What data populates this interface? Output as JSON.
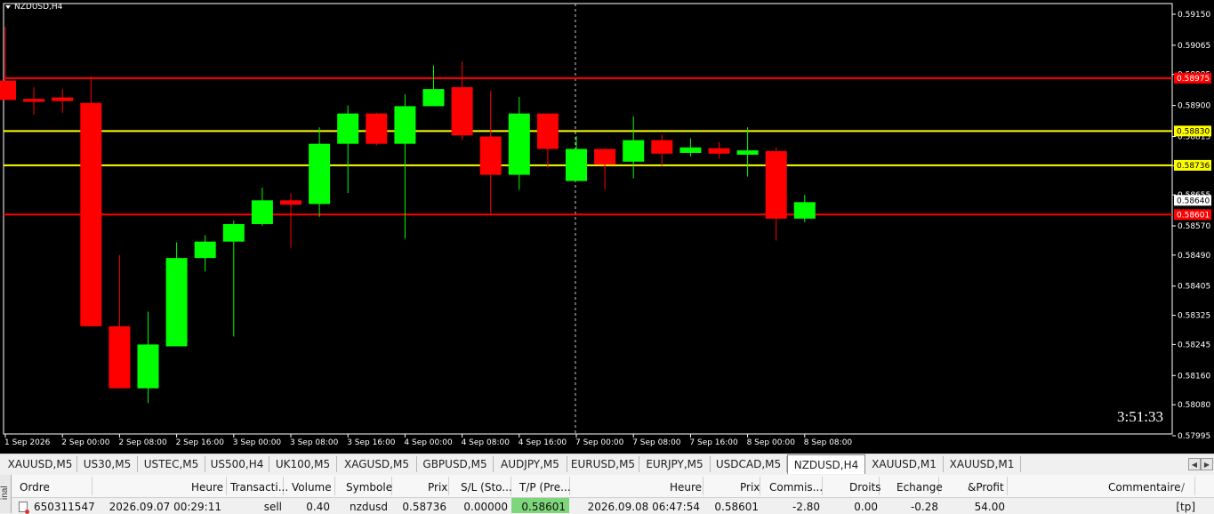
{
  "window": {
    "title": "NZDUSD,H4",
    "timer": "3:51:33"
  },
  "colors": {
    "bull": "#00ff00",
    "bear": "#ff0000",
    "background": "#000000",
    "support_resistance_red": "#ff0000",
    "yellow_level": "#ffff00",
    "tp_highlight": "#7ed67a"
  },
  "chart_data": {
    "type": "candlestick",
    "symbol": "NZDUSD",
    "timeframe": "H4",
    "ylim": [
      0.57995,
      0.5915
    ],
    "y_ticks": [
      0.5915,
      0.59065,
      0.58985,
      0.589,
      0.58815,
      0.58735,
      0.58655,
      0.5857,
      0.5849,
      0.58405,
      0.58325,
      0.58245,
      0.5816,
      0.5808,
      0.57995
    ],
    "y_tick_labels": [
      "0.59150",
      "0.59065",
      "0.58985",
      "0.58900",
      "0.58815",
      "0.58735",
      "0.58655",
      "0.58570",
      "0.58490",
      "0.58405",
      "0.58325",
      "0.58245",
      "0.58160",
      "0.58080",
      "0.57995"
    ],
    "x_tick_labels": [
      "1 Sep 2026",
      "2 Sep 00:00",
      "2 Sep 08:00",
      "2 Sep 16:00",
      "3 Sep 00:00",
      "3 Sep 08:00",
      "3 Sep 16:00",
      "4 Sep 00:00",
      "4 Sep 08:00",
      "4 Sep 16:00",
      "7 Sep 00:00",
      "7 Sep 08:00",
      "7 Sep 16:00",
      "8 Sep 00:00",
      "8 Sep 08:00"
    ],
    "candles": [
      {
        "o": 0.58968,
        "h": 0.59115,
        "l": 0.58915,
        "c": 0.58915
      },
      {
        "o": 0.58918,
        "h": 0.5895,
        "l": 0.58875,
        "c": 0.5891
      },
      {
        "o": 0.58922,
        "h": 0.58945,
        "l": 0.5888,
        "c": 0.58912
      },
      {
        "o": 0.58907,
        "h": 0.5898,
        "l": 0.58295,
        "c": 0.58295
      },
      {
        "o": 0.58295,
        "h": 0.5849,
        "l": 0.58125,
        "c": 0.58125
      },
      {
        "o": 0.58125,
        "h": 0.58335,
        "l": 0.58085,
        "c": 0.58245
      },
      {
        "o": 0.5824,
        "h": 0.58525,
        "l": 0.5824,
        "c": 0.58482
      },
      {
        "o": 0.58482,
        "h": 0.58545,
        "l": 0.58445,
        "c": 0.58527
      },
      {
        "o": 0.58527,
        "h": 0.58585,
        "l": 0.58267,
        "c": 0.58575
      },
      {
        "o": 0.58575,
        "h": 0.58675,
        "l": 0.5857,
        "c": 0.5864
      },
      {
        "o": 0.5864,
        "h": 0.5866,
        "l": 0.5851,
        "c": 0.58628
      },
      {
        "o": 0.5863,
        "h": 0.5884,
        "l": 0.58595,
        "c": 0.58795
      },
      {
        "o": 0.58795,
        "h": 0.589,
        "l": 0.5866,
        "c": 0.58878
      },
      {
        "o": 0.58878,
        "h": 0.5888,
        "l": 0.5879,
        "c": 0.58795
      },
      {
        "o": 0.58795,
        "h": 0.5893,
        "l": 0.58535,
        "c": 0.58898
      },
      {
        "o": 0.58898,
        "h": 0.5901,
        "l": 0.58905,
        "c": 0.58945
      },
      {
        "o": 0.5895,
        "h": 0.5902,
        "l": 0.58805,
        "c": 0.58818
      },
      {
        "o": 0.58815,
        "h": 0.5894,
        "l": 0.58605,
        "c": 0.5871
      },
      {
        "o": 0.5871,
        "h": 0.58923,
        "l": 0.58669,
        "c": 0.58878
      },
      {
        "o": 0.58878,
        "h": 0.58878,
        "l": 0.58729,
        "c": 0.58781
      },
      {
        "o": 0.58693,
        "h": 0.58816,
        "l": 0.58693,
        "c": 0.58781
      },
      {
        "o": 0.58781,
        "h": 0.58781,
        "l": 0.58669,
        "c": 0.58738
      },
      {
        "o": 0.58746,
        "h": 0.5887,
        "l": 0.587,
        "c": 0.58805
      },
      {
        "o": 0.58805,
        "h": 0.5882,
        "l": 0.58735,
        "c": 0.58768
      },
      {
        "o": 0.5877,
        "h": 0.5881,
        "l": 0.5876,
        "c": 0.58785
      },
      {
        "o": 0.58783,
        "h": 0.588,
        "l": 0.58755,
        "c": 0.58768
      },
      {
        "o": 0.58765,
        "h": 0.5884,
        "l": 0.58705,
        "c": 0.58777
      },
      {
        "o": 0.58775,
        "h": 0.58785,
        "l": 0.5853,
        "c": 0.5859
      },
      {
        "o": 0.5859,
        "h": 0.58655,
        "l": 0.5858,
        "c": 0.58635
      }
    ],
    "hlines": [
      {
        "value": 0.58975,
        "color": "#ff0000",
        "label": "0.58975"
      },
      {
        "value": 0.5883,
        "color": "#ffff00",
        "label": "0.58830"
      },
      {
        "value": 0.58736,
        "color": "#ffff00",
        "label": "0.58736"
      },
      {
        "value": 0.58601,
        "color": "#ff0000",
        "label": "0.58601"
      }
    ],
    "current_price": {
      "value": 0.5864,
      "label": "0.58640"
    },
    "vline_after_tick": "7 Sep 00:00",
    "grid": false,
    "legend": "none"
  },
  "tabs": [
    "XAUUSD,M5",
    "US30,M5",
    "USTEC,M5",
    "US500,H4",
    "UK100,M5",
    "XAGUSD,M5",
    "GBPUSD,M5",
    "AUDJPY,M5",
    "EURUSD,M5",
    "EURJPY,M5",
    "USDCAD,M5",
    "NZDUSD,H4",
    "XAUUSD,M1",
    "XAUUSD,M1"
  ],
  "active_tab": "NZDUSD,H4",
  "terminal": {
    "side_label": "inal",
    "columns": [
      "Ordre",
      "Heure",
      "Transacti...",
      "Volume",
      "Symbole",
      "Prix",
      "S/L (Sto...",
      "T/P (Pre...",
      "Heure",
      "Prix",
      "Commis...",
      "Droits",
      "Echange",
      "&Profit",
      "Commentaire"
    ],
    "rows": [
      {
        "ordre": "650311547",
        "heure": "2026.09.07 00:29:11",
        "type": "sell",
        "volume": "0.40",
        "symbole": "nzdusd",
        "prix": "0.58736",
        "sl": "0.00000",
        "tp": "0.58601",
        "heure2": "2026.09.08 06:47:54",
        "prix2": "0.58601",
        "commission": "-2.80",
        "droits": "0.00",
        "echange": "-0.28",
        "profit": "54.00",
        "commentaire": "[tp]"
      }
    ]
  }
}
